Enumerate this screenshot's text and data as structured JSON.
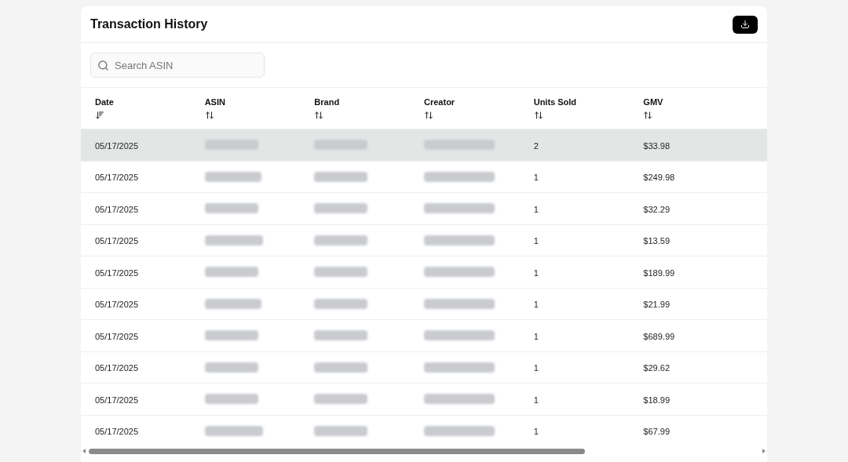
{
  "title": "Transaction History",
  "search": {
    "placeholder": "Search ASIN"
  },
  "columns": [
    {
      "label": "Date",
      "sorted": true
    },
    {
      "label": "ASIN",
      "sorted": false
    },
    {
      "label": "Brand",
      "sorted": false
    },
    {
      "label": "Creator",
      "sorted": false
    },
    {
      "label": "Units Sold",
      "sorted": false
    },
    {
      "label": "GMV",
      "sorted": false
    }
  ],
  "rows": [
    {
      "date": "05/17/2025",
      "units": "2",
      "gmv": "$33.98",
      "selected": true
    },
    {
      "date": "05/17/2025",
      "units": "1",
      "gmv": "$249.98",
      "selected": false
    },
    {
      "date": "05/17/2025",
      "units": "1",
      "gmv": "$32.29",
      "selected": false
    },
    {
      "date": "05/17/2025",
      "units": "1",
      "gmv": "$13.59",
      "selected": false
    },
    {
      "date": "05/17/2025",
      "units": "1",
      "gmv": "$189.99",
      "selected": false
    },
    {
      "date": "05/17/2025",
      "units": "1",
      "gmv": "$21.99",
      "selected": false
    },
    {
      "date": "05/17/2025",
      "units": "1",
      "gmv": "$689.99",
      "selected": false
    },
    {
      "date": "05/17/2025",
      "units": "1",
      "gmv": "$29.62",
      "selected": false
    },
    {
      "date": "05/17/2025",
      "units": "1",
      "gmv": "$18.99",
      "selected": false
    },
    {
      "date": "05/17/2025",
      "units": "1",
      "gmv": "$67.99",
      "selected": false
    }
  ]
}
